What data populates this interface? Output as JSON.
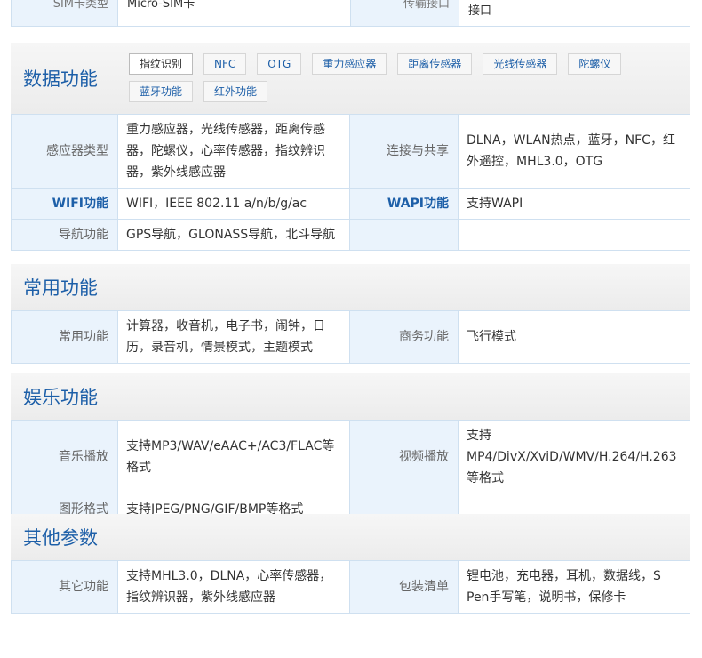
{
  "top_row": {
    "label1": "SIM卡类型",
    "value1": "Micro-SIM卡",
    "label2": "传输接口",
    "value2": "接口"
  },
  "sections": {
    "data": {
      "title": "数据功能",
      "tags": [
        "指纹识别",
        "NFC",
        "OTG",
        "重力感应器",
        "距离传感器",
        "光线传感器",
        "陀螺仪",
        "蓝牙功能",
        "红外功能"
      ],
      "rows": [
        {
          "l1": "感应器类型",
          "v1": "重力感应器，光线传感器，距离传感器，陀螺仪，心率传感器，指纹辨识器，紫外线感应器",
          "l2": "连接与共享",
          "v2": "DLNA，WLAN热点，蓝牙，NFC，红外遥控，MHL3.0，OTG"
        },
        {
          "l1": "WIFI功能",
          "v1": "WIFI，IEEE 802.11 a/n/b/g/ac",
          "l2": "WAPI功能",
          "v2": "支持WAPI"
        },
        {
          "l1": "导航功能",
          "v1": "GPS导航，GLONASS导航，北斗导航",
          "l2": "",
          "v2": ""
        }
      ]
    },
    "common": {
      "title": "常用功能",
      "rows": [
        {
          "l1": "常用功能",
          "v1": "计算器，收音机，电子书，闹钟，日历，录音机，情景模式，主题模式",
          "l2": "商务功能",
          "v2": "飞行模式"
        }
      ]
    },
    "ent": {
      "title": "娱乐功能",
      "rows": [
        {
          "l1": "音乐播放",
          "v1": "支持MP3/WAV/eAAC+/AC3/FLAC等格式",
          "l2": "视频播放",
          "v2": "支持MP4/DivX/XviD/WMV/H.264/H.263等格式"
        },
        {
          "l1": "图形格式",
          "v1": "支持JPEG/PNG/GIF/BMP等格式",
          "l2": "",
          "v2": ""
        }
      ]
    },
    "other": {
      "title": "其他参数",
      "rows": [
        {
          "l1": "其它功能",
          "v1": "支持MHL3.0，DLNA，心率传感器，指纹辨识器，紫外线感应器",
          "l2": "包装清单",
          "v2": "锂电池，充电器，耳机，数据线，S Pen手写笔，说明书，保修卡"
        }
      ]
    }
  },
  "colors": {
    "accent": "#1d5fa8",
    "label_bg": "#eaf3fc",
    "border": "#cfe0f0"
  }
}
